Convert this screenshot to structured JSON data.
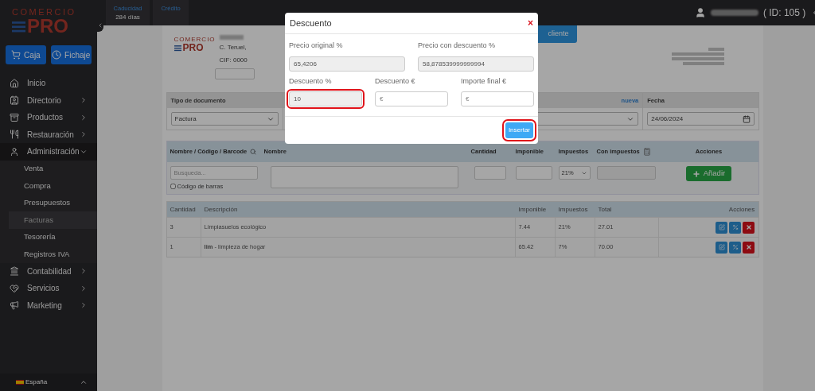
{
  "top_bar": {
    "stats": [
      {
        "label": "Caducidad",
        "value": "284 días"
      },
      {
        "label": "Crédito"
      }
    ],
    "user_id": "( ID: 105 )"
  },
  "sidebar": {
    "logo": {
      "top": "COMERCIO",
      "bottom": "PRO"
    },
    "buttons": [
      {
        "label": "Caja"
      },
      {
        "label": "Fichaje"
      }
    ],
    "items": [
      {
        "label": "Inicio",
        "kind": "link"
      },
      {
        "label": "Directorio",
        "kind": "group",
        "expanded": false
      },
      {
        "label": "Productos",
        "kind": "group",
        "expanded": false
      },
      {
        "label": "Restauración",
        "kind": "group",
        "expanded": false
      },
      {
        "label": "Administración",
        "kind": "group",
        "expanded": true,
        "children": [
          {
            "label": "Venta",
            "selected": false
          },
          {
            "label": "Compra",
            "selected": false
          },
          {
            "label": "Presupuestos",
            "selected": false
          },
          {
            "label": "Facturas",
            "selected": true
          },
          {
            "label": "Tesorería",
            "selected": false
          },
          {
            "label": "Registros IVA",
            "selected": false
          }
        ]
      },
      {
        "label": "Contabilidad",
        "kind": "group",
        "expanded": false
      },
      {
        "label": "Servicios",
        "kind": "group",
        "expanded": false
      },
      {
        "label": "Marketing",
        "kind": "group",
        "expanded": false
      }
    ],
    "footer": "España"
  },
  "document": {
    "logo": {
      "top": "COMERCIO",
      "bottom": "PRO"
    },
    "client_button": "cliente",
    "address_lines": [
      "C. Teruel,",
      "CIF: 0000"
    ],
    "header_fields": [
      {
        "label": "Tipo de documento",
        "value": "Factura",
        "kind": "select"
      },
      {
        "label": "nueva",
        "kind": "select"
      },
      {
        "label": "Fecha",
        "value": "24/06/2024",
        "kind": "date"
      }
    ]
  },
  "item_form": {
    "columns": [
      "Nombre / Código / Barcode",
      "Nombre",
      "Cantidad",
      "Imponible",
      "Impuestos",
      "Con impuestos",
      "Acciones"
    ],
    "search_placeholder": "Busqueda...",
    "barcode_checkbox": {
      "label": "Código de barras",
      "checked": false
    },
    "tax_value": "21%",
    "add_button": "Añadir"
  },
  "lines": {
    "columns": [
      "Cantidad",
      "Descripción",
      "Imponible",
      "Impuestos",
      "Total",
      "Acciones"
    ],
    "rows": [
      {
        "cells": [
          "3",
          "Limpiasuelos ecológico",
          "7.44",
          "21%",
          "27.01"
        ]
      },
      {
        "cells": [
          "1",
          "**lim** - limpieza de hogar",
          "65.42",
          "7%",
          "70.00"
        ]
      }
    ]
  },
  "modal": {
    "title": "Descuento",
    "close": "×",
    "top_fields": [
      {
        "label": "Precio original %",
        "value": "65,4206",
        "readonly": true
      },
      {
        "label": "Precio con descuento %",
        "value": "58,878539999999994",
        "readonly": true
      }
    ],
    "bottom_fields": [
      {
        "label": "Descuento %",
        "value": "10",
        "readonly": true,
        "highlighted": true
      },
      {
        "label": "Descuento €",
        "placeholder": "€",
        "readonly": false,
        "highlighted": false
      },
      {
        "label": "Importe final €",
        "placeholder": "€",
        "readonly": false,
        "highlighted": false
      }
    ],
    "button": {
      "label": "Insertar",
      "highlighted": true
    }
  }
}
